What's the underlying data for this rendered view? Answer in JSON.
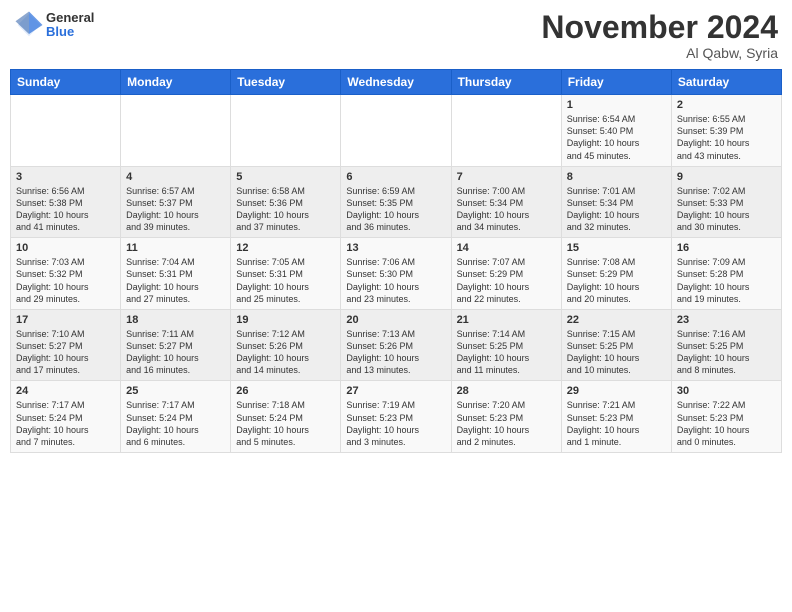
{
  "header": {
    "logo_general": "General",
    "logo_blue": "Blue",
    "month_title": "November 2024",
    "location": "Al Qabw, Syria"
  },
  "days_of_week": [
    "Sunday",
    "Monday",
    "Tuesday",
    "Wednesday",
    "Thursday",
    "Friday",
    "Saturday"
  ],
  "weeks": [
    [
      {
        "day": "",
        "info": ""
      },
      {
        "day": "",
        "info": ""
      },
      {
        "day": "",
        "info": ""
      },
      {
        "day": "",
        "info": ""
      },
      {
        "day": "",
        "info": ""
      },
      {
        "day": "1",
        "info": "Sunrise: 6:54 AM\nSunset: 5:40 PM\nDaylight: 10 hours\nand 45 minutes."
      },
      {
        "day": "2",
        "info": "Sunrise: 6:55 AM\nSunset: 5:39 PM\nDaylight: 10 hours\nand 43 minutes."
      }
    ],
    [
      {
        "day": "3",
        "info": "Sunrise: 6:56 AM\nSunset: 5:38 PM\nDaylight: 10 hours\nand 41 minutes."
      },
      {
        "day": "4",
        "info": "Sunrise: 6:57 AM\nSunset: 5:37 PM\nDaylight: 10 hours\nand 39 minutes."
      },
      {
        "day": "5",
        "info": "Sunrise: 6:58 AM\nSunset: 5:36 PM\nDaylight: 10 hours\nand 37 minutes."
      },
      {
        "day": "6",
        "info": "Sunrise: 6:59 AM\nSunset: 5:35 PM\nDaylight: 10 hours\nand 36 minutes."
      },
      {
        "day": "7",
        "info": "Sunrise: 7:00 AM\nSunset: 5:34 PM\nDaylight: 10 hours\nand 34 minutes."
      },
      {
        "day": "8",
        "info": "Sunrise: 7:01 AM\nSunset: 5:34 PM\nDaylight: 10 hours\nand 32 minutes."
      },
      {
        "day": "9",
        "info": "Sunrise: 7:02 AM\nSunset: 5:33 PM\nDaylight: 10 hours\nand 30 minutes."
      }
    ],
    [
      {
        "day": "10",
        "info": "Sunrise: 7:03 AM\nSunset: 5:32 PM\nDaylight: 10 hours\nand 29 minutes."
      },
      {
        "day": "11",
        "info": "Sunrise: 7:04 AM\nSunset: 5:31 PM\nDaylight: 10 hours\nand 27 minutes."
      },
      {
        "day": "12",
        "info": "Sunrise: 7:05 AM\nSunset: 5:31 PM\nDaylight: 10 hours\nand 25 minutes."
      },
      {
        "day": "13",
        "info": "Sunrise: 7:06 AM\nSunset: 5:30 PM\nDaylight: 10 hours\nand 23 minutes."
      },
      {
        "day": "14",
        "info": "Sunrise: 7:07 AM\nSunset: 5:29 PM\nDaylight: 10 hours\nand 22 minutes."
      },
      {
        "day": "15",
        "info": "Sunrise: 7:08 AM\nSunset: 5:29 PM\nDaylight: 10 hours\nand 20 minutes."
      },
      {
        "day": "16",
        "info": "Sunrise: 7:09 AM\nSunset: 5:28 PM\nDaylight: 10 hours\nand 19 minutes."
      }
    ],
    [
      {
        "day": "17",
        "info": "Sunrise: 7:10 AM\nSunset: 5:27 PM\nDaylight: 10 hours\nand 17 minutes."
      },
      {
        "day": "18",
        "info": "Sunrise: 7:11 AM\nSunset: 5:27 PM\nDaylight: 10 hours\nand 16 minutes."
      },
      {
        "day": "19",
        "info": "Sunrise: 7:12 AM\nSunset: 5:26 PM\nDaylight: 10 hours\nand 14 minutes."
      },
      {
        "day": "20",
        "info": "Sunrise: 7:13 AM\nSunset: 5:26 PM\nDaylight: 10 hours\nand 13 minutes."
      },
      {
        "day": "21",
        "info": "Sunrise: 7:14 AM\nSunset: 5:25 PM\nDaylight: 10 hours\nand 11 minutes."
      },
      {
        "day": "22",
        "info": "Sunrise: 7:15 AM\nSunset: 5:25 PM\nDaylight: 10 hours\nand 10 minutes."
      },
      {
        "day": "23",
        "info": "Sunrise: 7:16 AM\nSunset: 5:25 PM\nDaylight: 10 hours\nand 8 minutes."
      }
    ],
    [
      {
        "day": "24",
        "info": "Sunrise: 7:17 AM\nSunset: 5:24 PM\nDaylight: 10 hours\nand 7 minutes."
      },
      {
        "day": "25",
        "info": "Sunrise: 7:17 AM\nSunset: 5:24 PM\nDaylight: 10 hours\nand 6 minutes."
      },
      {
        "day": "26",
        "info": "Sunrise: 7:18 AM\nSunset: 5:24 PM\nDaylight: 10 hours\nand 5 minutes."
      },
      {
        "day": "27",
        "info": "Sunrise: 7:19 AM\nSunset: 5:23 PM\nDaylight: 10 hours\nand 3 minutes."
      },
      {
        "day": "28",
        "info": "Sunrise: 7:20 AM\nSunset: 5:23 PM\nDaylight: 10 hours\nand 2 minutes."
      },
      {
        "day": "29",
        "info": "Sunrise: 7:21 AM\nSunset: 5:23 PM\nDaylight: 10 hours\nand 1 minute."
      },
      {
        "day": "30",
        "info": "Sunrise: 7:22 AM\nSunset: 5:23 PM\nDaylight: 10 hours\nand 0 minutes."
      }
    ]
  ]
}
